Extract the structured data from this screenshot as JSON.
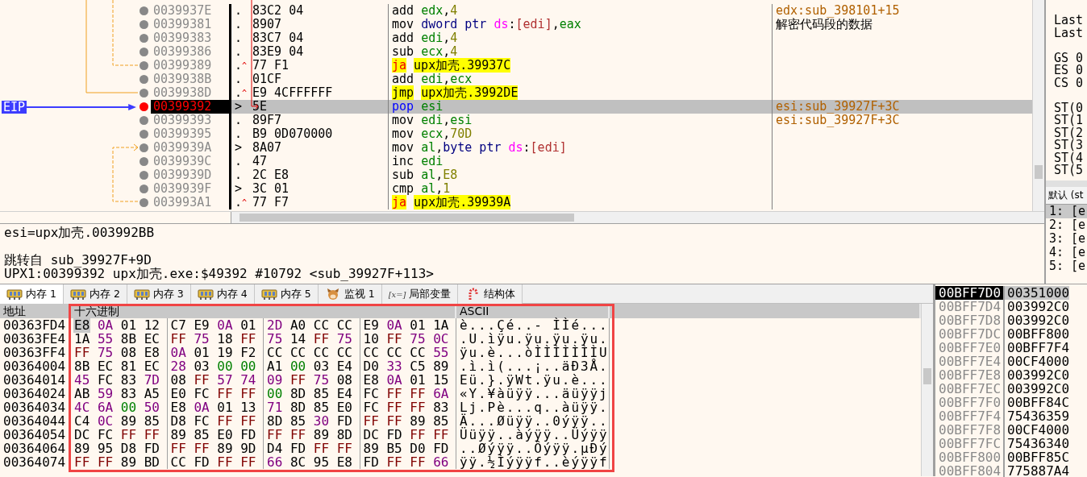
{
  "disassembly": {
    "rows": [
      {
        "address": "0039937E",
        "marker": ".",
        "bytes": "83C2 04",
        "instruction": [
          {
            "kind": "op",
            "text": "add"
          },
          {
            "kind": "reg",
            "text": "edx"
          },
          {
            "kind": "p",
            "text": ","
          },
          {
            "kind": "num",
            "text": "4"
          }
        ],
        "comment": {
          "kind": "auto",
          "text": "edx:sub_398101+15"
        },
        "current": false
      },
      {
        "address": "00399381",
        "marker": ".",
        "bytes": "8907",
        "instruction": [
          {
            "kind": "op",
            "text": "mov"
          },
          {
            "kind": "size",
            "text": "dword ptr"
          },
          {
            "kind": "seg",
            "text": "ds"
          },
          {
            "kind": "p",
            "text": ":"
          },
          {
            "kind": "mem",
            "text": "[edi]"
          },
          {
            "kind": "p",
            "text": ","
          },
          {
            "kind": "reg",
            "text": "eax"
          }
        ],
        "comment": {
          "kind": "user",
          "text": "解密代码段的数据"
        },
        "current": false
      },
      {
        "address": "00399383",
        "marker": ".",
        "bytes": "83C7 04",
        "instruction": [
          {
            "kind": "op",
            "text": "add"
          },
          {
            "kind": "reg",
            "text": "edi"
          },
          {
            "kind": "p",
            "text": ","
          },
          {
            "kind": "num",
            "text": "4"
          }
        ],
        "current": false
      },
      {
        "address": "00399386",
        "marker": ".",
        "bytes": "83E9 04",
        "instruction": [
          {
            "kind": "op",
            "text": "sub"
          },
          {
            "kind": "reg",
            "text": "ecx"
          },
          {
            "kind": "p",
            "text": ","
          },
          {
            "kind": "num",
            "text": "4"
          }
        ],
        "current": false
      },
      {
        "address": "00399389",
        "marker": ".",
        "jump_mark": "^",
        "bytes": "77 F1",
        "instruction": [
          {
            "kind": "cjump",
            "text": "ja"
          },
          {
            "kind": "target",
            "text": "upx加壳.39937C"
          }
        ],
        "current": false
      },
      {
        "address": "0039938B",
        "marker": ".",
        "bytes": "01CF",
        "instruction": [
          {
            "kind": "op",
            "text": "add"
          },
          {
            "kind": "reg",
            "text": "edi"
          },
          {
            "kind": "p",
            "text": ","
          },
          {
            "kind": "reg",
            "text": "ecx"
          }
        ],
        "current": false
      },
      {
        "address": "0039938D",
        "marker": ".",
        "jump_mark": "^",
        "bytes": "E9 4CFFFFFF",
        "instruction": [
          {
            "kind": "jump",
            "text": "jmp"
          },
          {
            "kind": "target",
            "text": "upx加壳.3992DE"
          }
        ],
        "current": false
      },
      {
        "address": "00399392",
        "label": "EIP",
        "marker": ">",
        "bytes": "5E",
        "instruction": [
          {
            "kind": "stack",
            "text": "pop"
          },
          {
            "kind": "reg",
            "text": "esi"
          }
        ],
        "comment": {
          "kind": "auto",
          "text": "esi:sub_39927F+3C"
        },
        "current": true
      },
      {
        "address": "00399393",
        "marker": ".",
        "bytes": "89F7",
        "instruction": [
          {
            "kind": "op",
            "text": "mov"
          },
          {
            "kind": "reg",
            "text": "edi"
          },
          {
            "kind": "p",
            "text": ","
          },
          {
            "kind": "reg",
            "text": "esi"
          }
        ],
        "comment": {
          "kind": "auto",
          "text": "esi:sub_39927F+3C"
        },
        "current": false
      },
      {
        "address": "00399395",
        "marker": ".",
        "bytes": "B9 0D070000",
        "instruction": [
          {
            "kind": "op",
            "text": "mov"
          },
          {
            "kind": "reg",
            "text": "ecx"
          },
          {
            "kind": "p",
            "text": ","
          },
          {
            "kind": "num",
            "text": "70D"
          }
        ],
        "current": false
      },
      {
        "address": "0039939A",
        "marker": ">",
        "bytes": "8A07",
        "instruction": [
          {
            "kind": "op",
            "text": "mov"
          },
          {
            "kind": "reg",
            "text": "al"
          },
          {
            "kind": "p",
            "text": ","
          },
          {
            "kind": "size",
            "text": "byte ptr"
          },
          {
            "kind": "seg",
            "text": "ds"
          },
          {
            "kind": "p",
            "text": ":"
          },
          {
            "kind": "mem",
            "text": "[edi]"
          }
        ],
        "current": false
      },
      {
        "address": "0039939C",
        "marker": ".",
        "bytes": "47",
        "instruction": [
          {
            "kind": "op",
            "text": "inc"
          },
          {
            "kind": "reg",
            "text": "edi"
          }
        ],
        "current": false
      },
      {
        "address": "0039939D",
        "marker": ".",
        "bytes": "2C E8",
        "instruction": [
          {
            "kind": "op",
            "text": "sub"
          },
          {
            "kind": "reg",
            "text": "al"
          },
          {
            "kind": "p",
            "text": ","
          },
          {
            "kind": "num",
            "text": "E8"
          }
        ],
        "current": false
      },
      {
        "address": "0039939F",
        "marker": ">",
        "bytes": "3C 01",
        "instruction": [
          {
            "kind": "op",
            "text": "cmp"
          },
          {
            "kind": "reg",
            "text": "al"
          },
          {
            "kind": "p",
            "text": ","
          },
          {
            "kind": "num",
            "text": "1"
          }
        ],
        "current": false
      },
      {
        "address": "003993A1",
        "marker": ".",
        "jump_mark": "^",
        "bytes": "77 F7",
        "instruction": [
          {
            "kind": "cjump",
            "text": "ja"
          },
          {
            "kind": "target",
            "text": "upx加壳.39939A"
          }
        ],
        "current": false
      }
    ]
  },
  "registers": [
    [
      "Last",
      "Last"
    ],
    [
      "GS 0",
      "ES 0",
      "CS 0"
    ],
    [
      "ST(0",
      "ST(1",
      "ST(2",
      "ST(3",
      "ST(4",
      "ST(5"
    ]
  ],
  "call_stack": {
    "header": "默认 (st",
    "items": [
      {
        "text": "1: [e",
        "selected": true
      },
      {
        "text": "2: [e",
        "selected": false
      },
      {
        "text": "3: [e",
        "selected": false
      },
      {
        "text": "4: [e",
        "selected": false
      },
      {
        "text": "5: [e",
        "selected": false
      }
    ]
  },
  "info": [
    [
      "esi=upx加壳.003992BB"
    ],
    [
      "跳转自 sub_39927F+9D",
      "UPX1:00399392 upx加壳.exe:$49392 #10792 <sub_39927F+113>"
    ]
  ],
  "tabs": [
    {
      "label": "内存 1",
      "kind": "memory",
      "selected": true
    },
    {
      "label": "内存 2",
      "kind": "memory",
      "selected": false
    },
    {
      "label": "内存 3",
      "kind": "memory",
      "selected": false
    },
    {
      "label": "内存 4",
      "kind": "memory",
      "selected": false
    },
    {
      "label": "内存 5",
      "kind": "memory",
      "selected": false
    },
    {
      "label": "监视 1",
      "kind": "watch",
      "selected": false
    },
    {
      "label": "局部变量",
      "kind": "locals",
      "icon_text": "[x=]",
      "selected": false
    },
    {
      "label": "结构体",
      "kind": "struct",
      "selected": false
    }
  ],
  "hex_dump": {
    "columns": [
      "地址",
      "十六进制",
      "ASCII"
    ],
    "annotation": {
      "kind": "frame"
    },
    "rows": [
      {
        "address": "00363FD4",
        "bytes": [
          {
            "text": "E8",
            "selected": true
          },
          "0A",
          "01",
          "12",
          "C7",
          "E9",
          "0A",
          "01",
          "2D",
          "A0",
          "CC",
          "CC",
          "E9",
          "0A",
          "01",
          "1A"
        ],
        "ascii": "è...Çé..- ÌÌé..."
      },
      {
        "address": "00363FE4",
        "bytes": [
          "1A",
          "55",
          "8B",
          "EC",
          "FF",
          "75",
          "18",
          "FF",
          "75",
          "14",
          "FF",
          "75",
          "10",
          "FF",
          "75",
          "0C"
        ],
        "ascii": ".U.ìÿu.ÿu.ÿu.ÿu."
      },
      {
        "address": "00363FF4",
        "bytes": [
          "FF",
          "75",
          "08",
          "E8",
          "0A",
          "01",
          "19",
          "F2",
          "CC",
          "CC",
          "CC",
          "CC",
          "CC",
          "CC",
          "CC",
          "55"
        ],
        "ascii": "ÿu.è...òÌÌÌÌÌÌÌU"
      },
      {
        "address": "00364004",
        "bytes": [
          "8B",
          "EC",
          "81",
          "EC",
          "28",
          "03",
          "00",
          "00",
          "A1",
          "00",
          "03",
          "E4",
          "D0",
          "33",
          "C5",
          "89"
        ],
        "ascii": ".ì.ì(...¡..äÐ3Å."
      },
      {
        "address": "00364014",
        "bytes": [
          "45",
          "FC",
          "83",
          "7D",
          "08",
          "FF",
          "57",
          "74",
          "09",
          "FF",
          "75",
          "08",
          "E8",
          "0A",
          "01",
          "15"
        ],
        "ascii": "Eü.}.ÿWt.ÿu.è..."
      },
      {
        "address": "00364024",
        "bytes": [
          "AB",
          "59",
          "83",
          "A5",
          "E0",
          "FC",
          "FF",
          "FF",
          "00",
          "8D",
          "85",
          "E4",
          "FC",
          "FF",
          "FF",
          "6A"
        ],
        "ascii": "«Y.¥àüÿÿ...äüÿÿj"
      },
      {
        "address": "00364034",
        "bytes": [
          "4C",
          "6A",
          "00",
          "50",
          "E8",
          "0A",
          "01",
          "13",
          "71",
          "8D",
          "85",
          "E0",
          "FC",
          "FF",
          "FF",
          "83"
        ],
        "ascii": "Lj.Pè...q..àüÿÿ."
      },
      {
        "address": "00364044",
        "bytes": [
          "C4",
          "0C",
          "89",
          "85",
          "D8",
          "FC",
          "FF",
          "FF",
          "8D",
          "85",
          "30",
          "FD",
          "FF",
          "FF",
          "89",
          "85"
        ],
        "ascii": "Ä...Øüÿÿ..0ýÿÿ.."
      },
      {
        "address": "00364054",
        "bytes": [
          "DC",
          "FC",
          "FF",
          "FF",
          "89",
          "85",
          "E0",
          "FD",
          "FF",
          "FF",
          "89",
          "8D",
          "DC",
          "FD",
          "FF",
          "FF"
        ],
        "ascii": "Üüÿÿ..àýÿÿ..Üýÿÿ"
      },
      {
        "address": "00364064",
        "bytes": [
          "89",
          "95",
          "D8",
          "FD",
          "FF",
          "FF",
          "89",
          "9D",
          "D4",
          "FD",
          "FF",
          "FF",
          "89",
          "B5",
          "D0",
          "FD"
        ],
        "ascii": "..Øýÿÿ..Ôýÿÿ.µÐý"
      },
      {
        "address": "00364074",
        "bytes": [
          "FF",
          "FF",
          "89",
          "BD",
          "CC",
          "FD",
          "FF",
          "FF",
          "66",
          "8C",
          "95",
          "E8",
          "FD",
          "FF",
          "FF",
          "66"
        ],
        "ascii": "ÿÿ.½Ìýÿÿf..èýÿÿf"
      }
    ]
  },
  "stack": [
    {
      "address": "00BFF7D0",
      "value": "00351000",
      "selected": true
    },
    {
      "address": "00BFF7D4",
      "value": "003992C0",
      "selected": false
    },
    {
      "address": "00BFF7D8",
      "value": "003992C0",
      "selected": false
    },
    {
      "address": "00BFF7DC",
      "value": "00BFF800",
      "selected": false
    },
    {
      "address": "00BFF7E0",
      "value": "00BFF7F4",
      "selected": false
    },
    {
      "address": "00BFF7E4",
      "value": "00CF4000",
      "selected": false
    },
    {
      "address": "00BFF7E8",
      "value": "003992C0",
      "selected": false
    },
    {
      "address": "00BFF7EC",
      "value": "003992C0",
      "selected": false
    },
    {
      "address": "00BFF7F0",
      "value": "00BFF84C",
      "selected": false
    },
    {
      "address": "00BFF7F4",
      "value": "75436359",
      "selected": false
    },
    {
      "address": "00BFF7F8",
      "value": "00CF4000",
      "selected": false
    },
    {
      "address": "00BFF7FC",
      "value": "75436340",
      "selected": false
    },
    {
      "address": "00BFF800",
      "value": "00BFF85C",
      "selected": false
    },
    {
      "address": "00BFF804",
      "value": "775887A4",
      "selected": false
    }
  ]
}
